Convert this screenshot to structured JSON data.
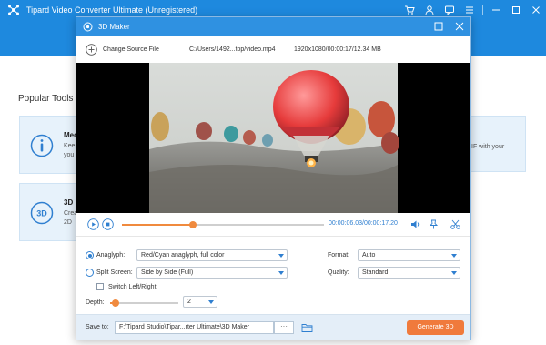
{
  "app": {
    "title": "Tipard Video Converter Ultimate (Unregistered)",
    "popular_tools_title": "Popular Tools",
    "cards": [
      {
        "title": "Med",
        "desc_line1": "Keep",
        "desc_line2": "you"
      },
      {
        "title": "3D I",
        "desc_line1": "Crea",
        "desc_line2": "2D"
      }
    ],
    "right_card_desc": "IF with your"
  },
  "dialog": {
    "title": "3D Maker",
    "change_source_label": "Change Source File",
    "source_path": "C:/Users/1492...top/video.mp4",
    "source_info": "1920x1080/00:00:17/12.34 MB",
    "playback": {
      "current_time": "00:00:06.03",
      "total_time": "00:00:17.20",
      "progress_fraction": 0.35
    },
    "settings": {
      "anaglyph_label": "Anaglyph:",
      "anaglyph_value": "Red/Cyan anaglyph, full color",
      "split_screen_label": "Split Screen:",
      "split_screen_value": "Side by Side (Full)",
      "switch_label": "Switch Left/Right",
      "depth_label": "Depth:",
      "depth_value": "2",
      "depth_fraction": 0.08,
      "format_label": "Format:",
      "format_value": "Auto",
      "quality_label": "Quality:",
      "quality_value": "Standard"
    },
    "footer": {
      "save_to_label": "Save to:",
      "save_path": "F:\\Tipard Studio\\Tipar...rter Ultimate\\3D Maker",
      "browse_label": "···",
      "generate_label": "Generate 3D"
    }
  },
  "colors": {
    "brand_blue": "#1e89de",
    "dialog_blue": "#2f91e1",
    "accent_orange": "#f07a3c"
  }
}
